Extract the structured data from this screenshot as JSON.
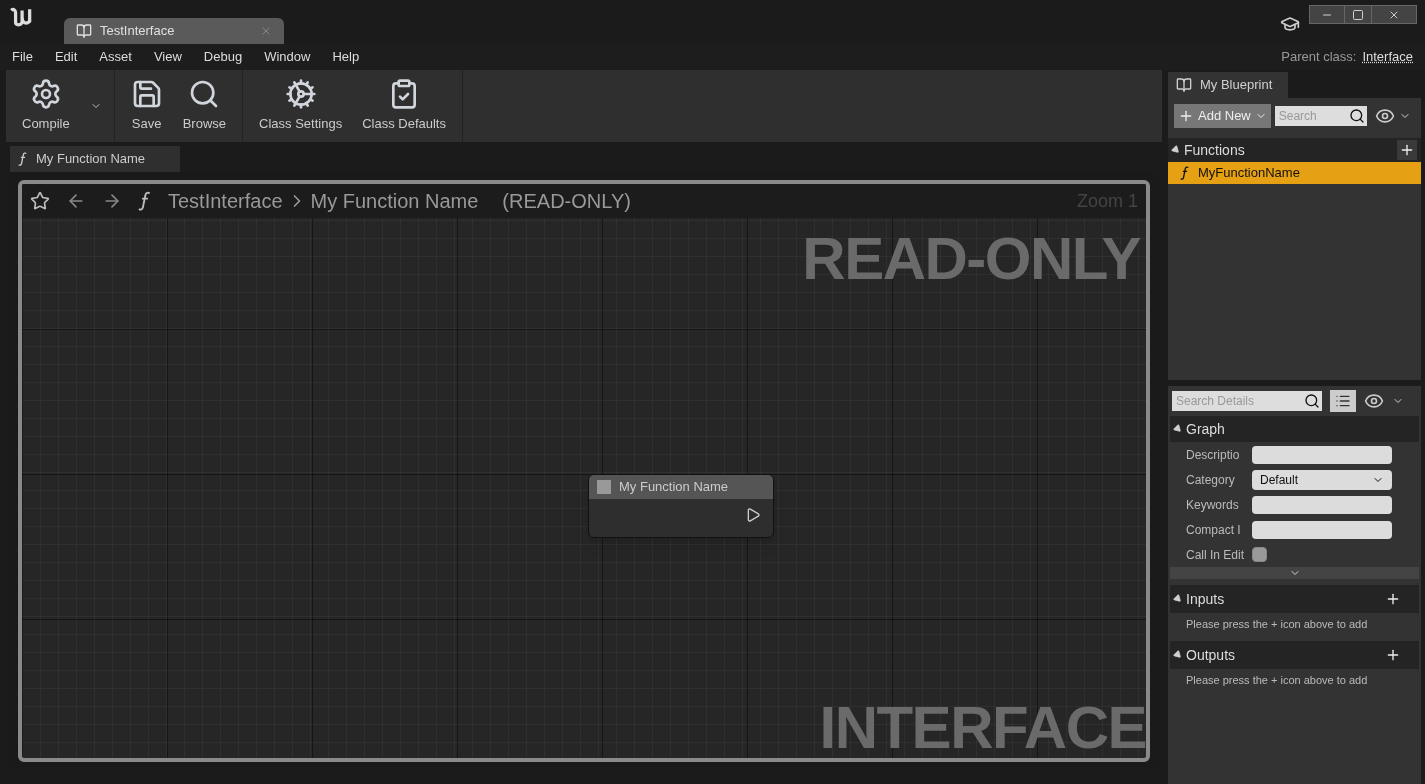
{
  "window": {
    "tab_title": "TestInterface",
    "parent_class_label": "Parent class:",
    "parent_class_value": "Interface"
  },
  "menu": [
    "File",
    "Edit",
    "Asset",
    "View",
    "Debug",
    "Window",
    "Help"
  ],
  "toolbar": [
    [
      {
        "label": "Compile",
        "kind": "compile"
      }
    ],
    [
      {
        "label": "Save",
        "kind": "save"
      },
      {
        "label": "Browse",
        "kind": "browse"
      }
    ],
    [
      {
        "label": "Class Settings",
        "kind": "settings"
      },
      {
        "label": "Class Defaults",
        "kind": "defaults"
      }
    ]
  ],
  "document_tab": {
    "title": "My Function Name"
  },
  "graph": {
    "breadcrumb": [
      "TestInterface",
      "My Function Name"
    ],
    "mode": "(READ-ONLY)",
    "zoom": "Zoom 1",
    "overlay_top": "READ-ONLY",
    "overlay_bottom": "INTERFACE",
    "node": {
      "title": "My Function Name"
    }
  },
  "my_blueprint": {
    "tab": "My Blueprint",
    "add_new": "Add New",
    "search_placeholder": "Search",
    "sections": [
      {
        "title": "Functions",
        "items": [
          {
            "label": "MyFunctionName",
            "selected": true
          }
        ]
      }
    ]
  },
  "details": {
    "search_placeholder": "Search Details",
    "graph": {
      "title": "Graph",
      "fields": [
        {
          "label": "Descriptio",
          "kind": "text"
        },
        {
          "label": "Category",
          "kind": "dropdown",
          "value": "Default"
        },
        {
          "label": "Keywords",
          "kind": "text"
        },
        {
          "label": "Compact I",
          "kind": "text"
        },
        {
          "label": "Call In Edit",
          "kind": "checkbox",
          "checked": false
        }
      ]
    },
    "sections": [
      {
        "title": "Inputs",
        "hint": "Please press the + icon above to add"
      },
      {
        "title": "Outputs",
        "hint": "Please press the + icon above to add"
      }
    ]
  }
}
